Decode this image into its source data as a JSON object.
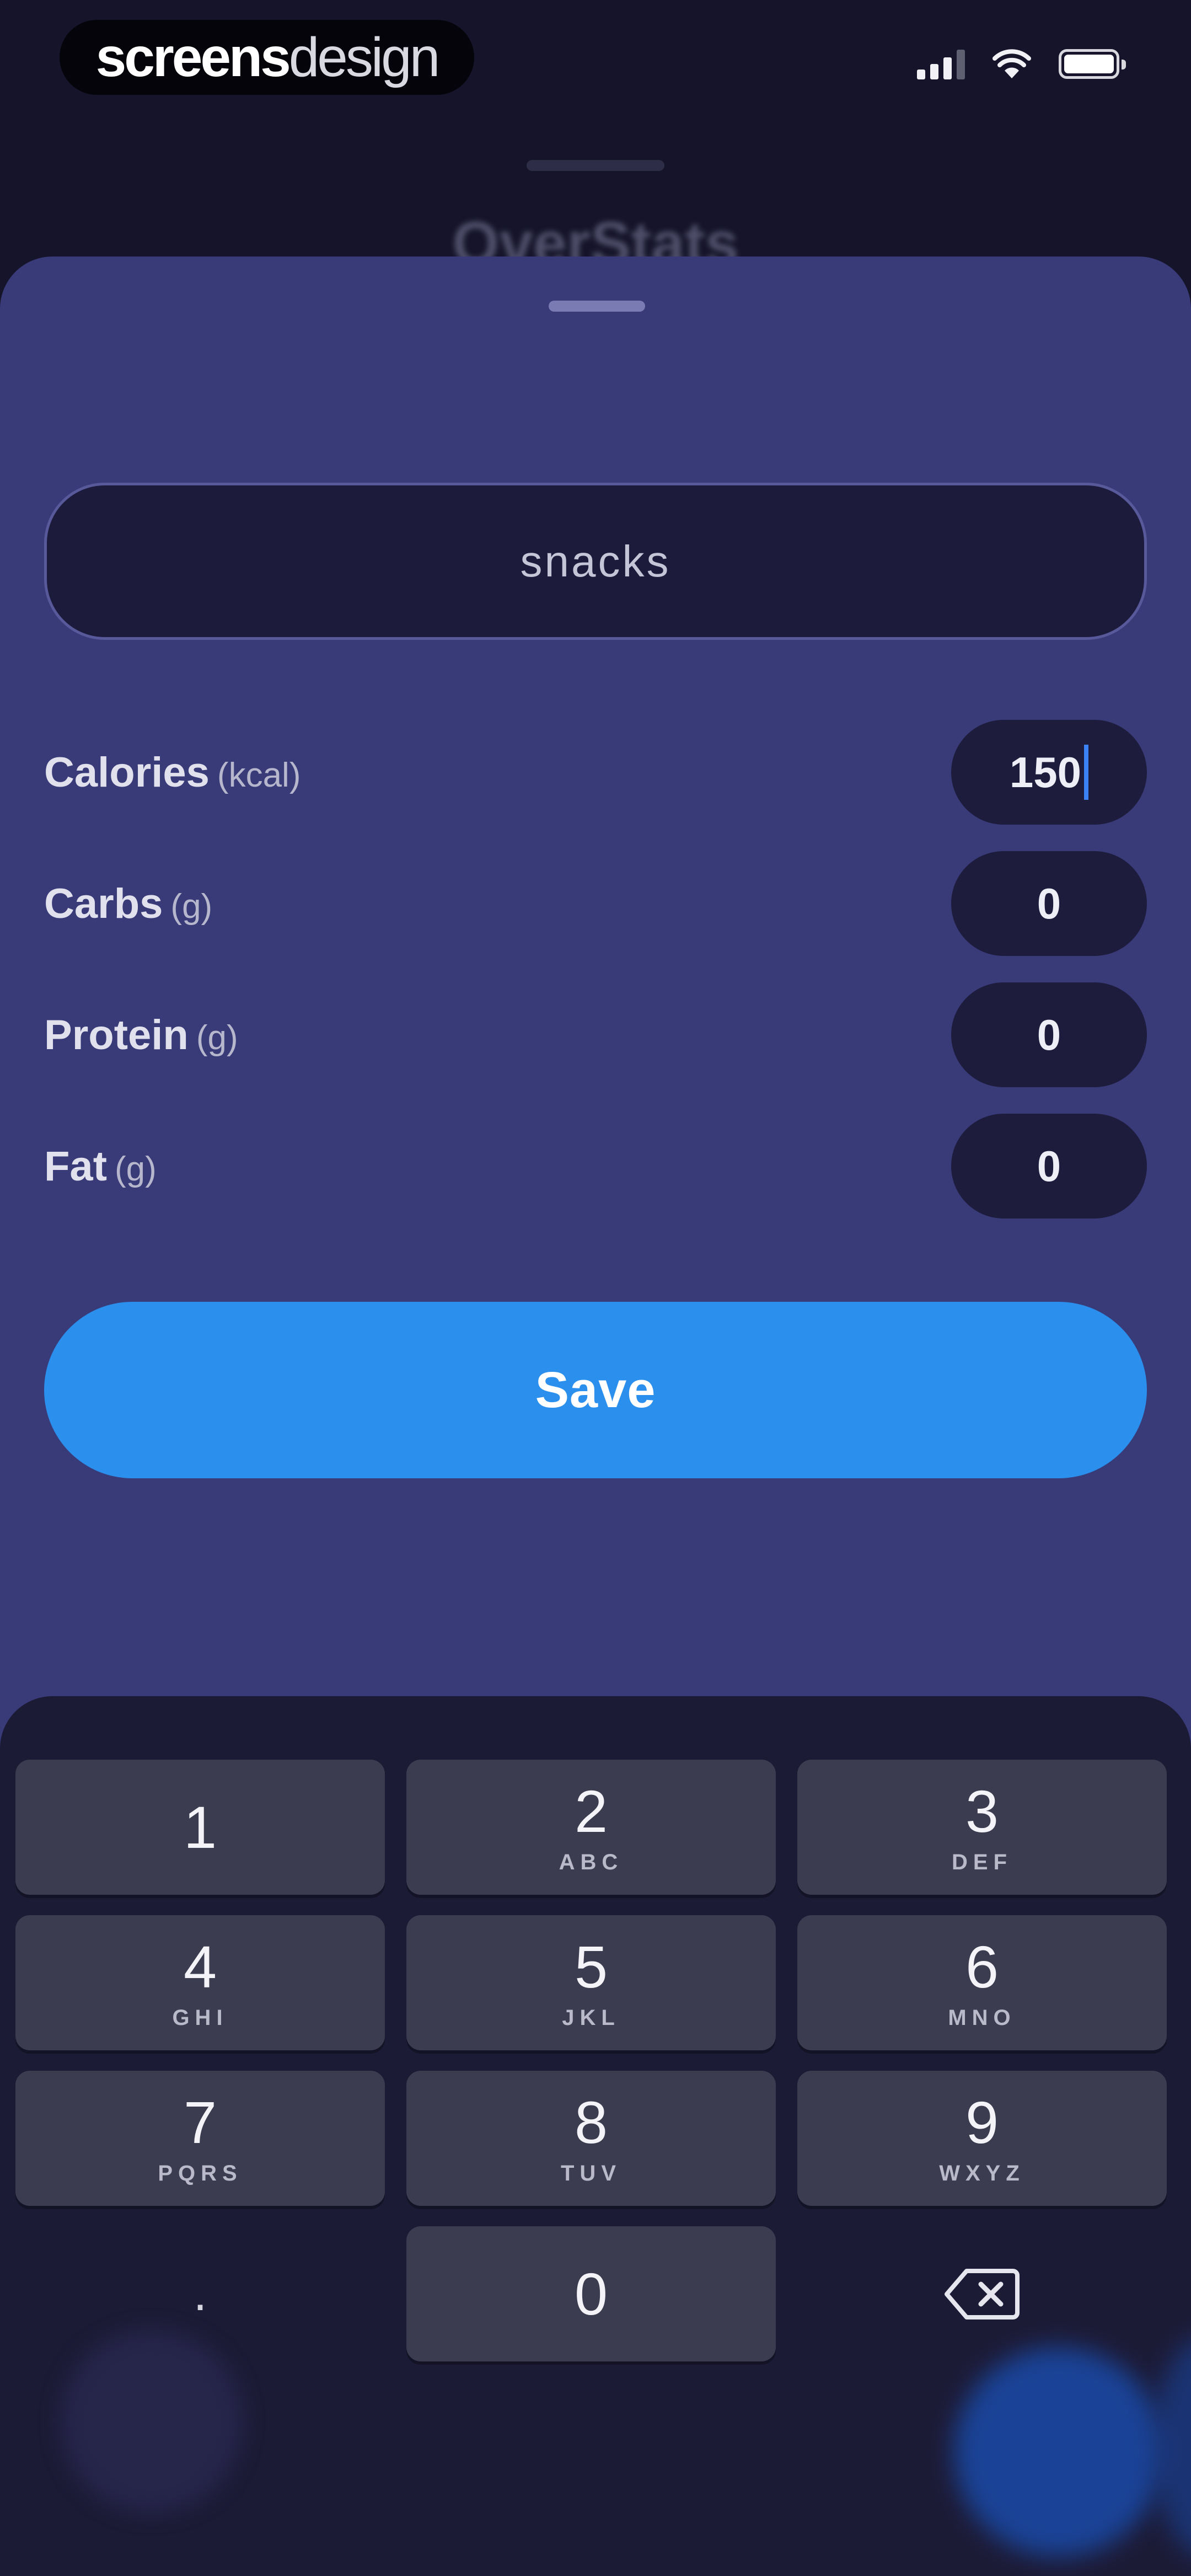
{
  "status_bar": {
    "brand_bold": "screens",
    "brand_light": "design"
  },
  "background": {
    "title": "OverStats"
  },
  "sheet": {
    "name_value": "snacks",
    "nutrients": [
      {
        "label": "Calories",
        "unit": "(kcal)",
        "value": "150"
      },
      {
        "label": "Carbs",
        "unit": "(g)",
        "value": "0"
      },
      {
        "label": "Protein",
        "unit": "(g)",
        "value": "0"
      },
      {
        "label": "Fat",
        "unit": "(g)",
        "value": "0"
      }
    ],
    "save_label": "Save"
  },
  "keypad": {
    "keys": [
      {
        "digit": "1",
        "letters": ""
      },
      {
        "digit": "2",
        "letters": "ABC"
      },
      {
        "digit": "3",
        "letters": "DEF"
      },
      {
        "digit": "4",
        "letters": "GHI"
      },
      {
        "digit": "5",
        "letters": "JKL"
      },
      {
        "digit": "6",
        "letters": "MNO"
      },
      {
        "digit": "7",
        "letters": "PQRS"
      },
      {
        "digit": "8",
        "letters": "TUV"
      },
      {
        "digit": "9",
        "letters": "WXYZ"
      },
      {
        "digit": "0",
        "letters": ""
      }
    ],
    "decimal_label": ".",
    "delete_icon": "backspace-icon"
  },
  "colors": {
    "sheet_background": "#393a78",
    "save_button": "#2b8fee",
    "keypad_background": "#1c1b36"
  }
}
